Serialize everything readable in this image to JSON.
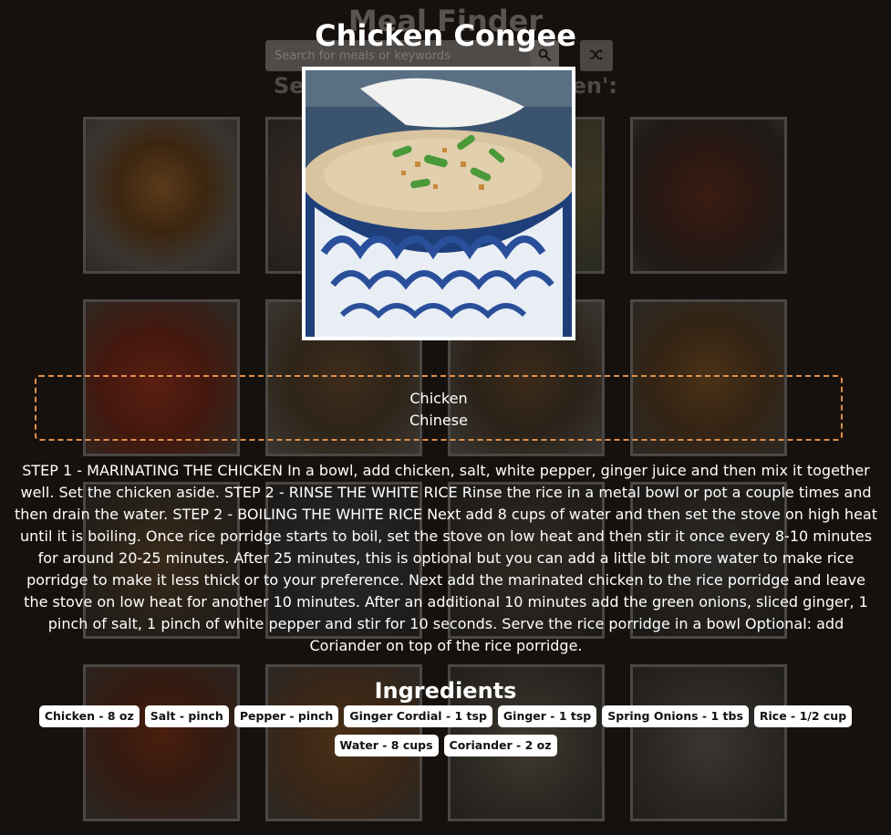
{
  "app": {
    "title": "Meal Finder",
    "search_placeholder": "Search for meals or keywords",
    "search_icon": "search-icon",
    "random_icon": "shuffle-icon",
    "results_heading": "Search results for 'chicken':",
    "result_cards": 16
  },
  "meal": {
    "name": "Chicken Congee",
    "image_alt": "Chicken Congee",
    "category": "Chicken",
    "area": "Chinese",
    "instructions": "STEP 1 - MARINATING THE CHICKEN In a bowl, add chicken, salt, white pepper, ginger juice and then mix it together well. Set the chicken aside. STEP 2 - RINSE THE WHITE RICE Rinse the rice in a metal bowl or pot a couple times and then drain the water. STEP 2 - BOILING THE WHITE RICE Next add 8 cups of water and then set the stove on high heat until it is boiling. Once rice porridge starts to boil, set the stove on low heat and then stir it once every 8-10 minutes for around 20-25 minutes. After 25 minutes, this is optional but you can add a little bit more water to make rice porridge to make it less thick or to your preference. Next add the marinated chicken to the rice porridge and leave the stove on low heat for another 10 minutes. After an additional 10 minutes add the green onions, sliced ginger, 1 pinch of salt, 1 pinch of white pepper and stir for 10 seconds. Serve the rice porridge in a bowl Optional: add Coriander on top of the rice porridge.",
    "ingredients_heading": "Ingredients",
    "ingredients": [
      "Chicken - 8 oz",
      "Salt - pinch",
      "Pepper - pinch",
      "Ginger Cordial - 1 tsp",
      "Ginger - 1 tsp",
      "Spring Onions - 1 tbs",
      "Rice - 1/2 cup",
      "Water - 8 cups",
      "Coriander - 2 oz"
    ]
  },
  "colors": {
    "background": "#17110d",
    "info_border": "#e0904a",
    "tag_background": "#ffffff"
  }
}
